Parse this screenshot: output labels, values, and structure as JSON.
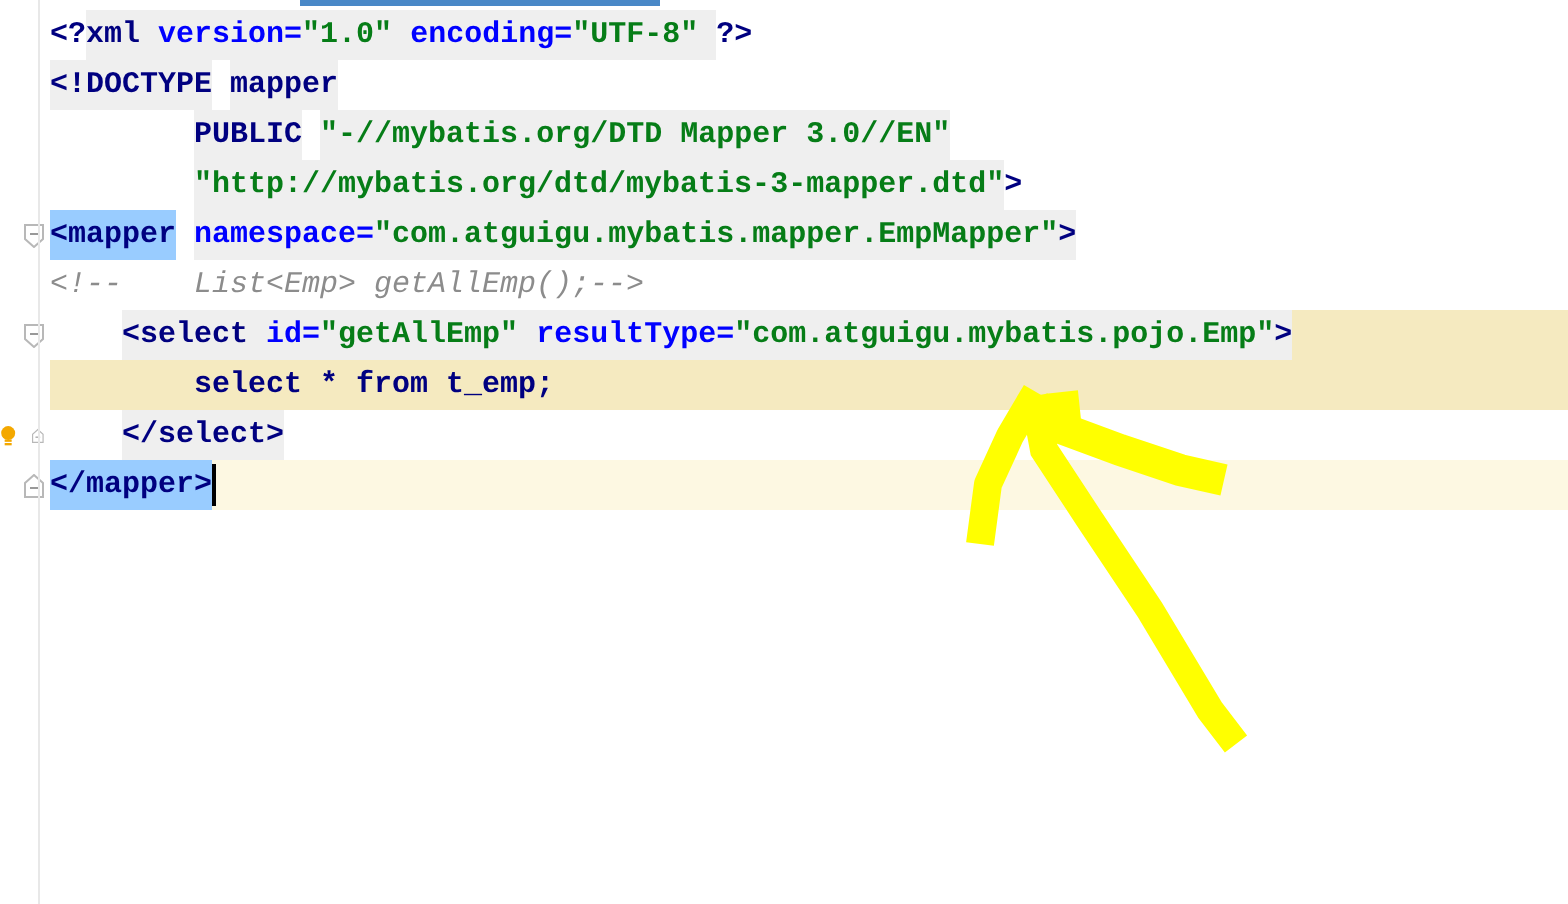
{
  "editor": {
    "lines": [
      {
        "tokens": [
          {
            "text": "<?",
            "kind": "bracket",
            "shaded": false
          },
          {
            "text": "xml ",
            "kind": "tag",
            "shaded": true
          },
          {
            "text": "version=",
            "kind": "attr",
            "shaded": true
          },
          {
            "text": "\"1.0\" ",
            "kind": "value",
            "shaded": true
          },
          {
            "text": "encoding=",
            "kind": "attr",
            "shaded": true
          },
          {
            "text": "\"UTF-8\" ",
            "kind": "value",
            "shaded": true
          },
          {
            "text": "?>",
            "kind": "bracket",
            "shaded": false
          }
        ]
      },
      {
        "tokens": [
          {
            "text": "<!DOCTYPE",
            "kind": "bracket",
            "shaded": true
          },
          {
            "text": " mapper",
            "kind": "tag",
            "shaded": true
          }
        ]
      },
      {
        "tokens": [
          {
            "text": "        PUBLIC",
            "kind": "tag",
            "shaded": true
          },
          {
            "text": " \"-//mybatis.org/DTD Mapper 3.0//EN\"",
            "kind": "value",
            "shaded": true
          }
        ]
      },
      {
        "tokens": [
          {
            "text": "        \"http://mybatis.org/dtd/mybatis-3-mapper.dtd\"",
            "kind": "value",
            "shaded": true
          },
          {
            "text": ">",
            "kind": "tag",
            "shaded": false
          }
        ]
      },
      {
        "fold_start": true,
        "tokens": [
          {
            "text": "<mapper",
            "kind": "tag",
            "matched": true
          },
          {
            "text": " namespace=",
            "kind": "attr",
            "shaded": true
          },
          {
            "text": "\"com.atguigu.mybatis.mapper.EmpMapper\"",
            "kind": "value",
            "shaded": true
          },
          {
            "text": ">",
            "kind": "tag",
            "shaded": true
          }
        ]
      },
      {
        "tokens": [
          {
            "text": "<!--    List<Emp> getAllEmp();-->",
            "kind": "comment",
            "shaded": false
          }
        ]
      },
      {
        "block_start": true,
        "fold_start": true,
        "tokens": [
          {
            "text": "    <select ",
            "kind": "tag",
            "shaded": true
          },
          {
            "text": "id=",
            "kind": "attr",
            "shaded": true
          },
          {
            "text": "\"getAllEmp\" ",
            "kind": "value",
            "shaded": true
          },
          {
            "text": "resultType=",
            "kind": "attr",
            "shaded": true
          },
          {
            "text": "\"com.atguigu.mybatis.pojo.Emp\"",
            "kind": "value",
            "shaded": true
          },
          {
            "text": ">",
            "kind": "tag",
            "shaded": true
          }
        ]
      },
      {
        "in_block": true,
        "tokens": [
          {
            "text": "        select * from t_emp;",
            "kind": "sql",
            "shaded": false
          }
        ]
      },
      {
        "fold_end": true,
        "bulb": true,
        "tokens": [
          {
            "text": "    </select>",
            "kind": "tag",
            "shaded": true
          }
        ]
      },
      {
        "caret_line": true,
        "fold_end": true,
        "tokens": [
          {
            "text": "</mapper>",
            "kind": "tag",
            "matched": true
          }
        ]
      }
    ]
  }
}
